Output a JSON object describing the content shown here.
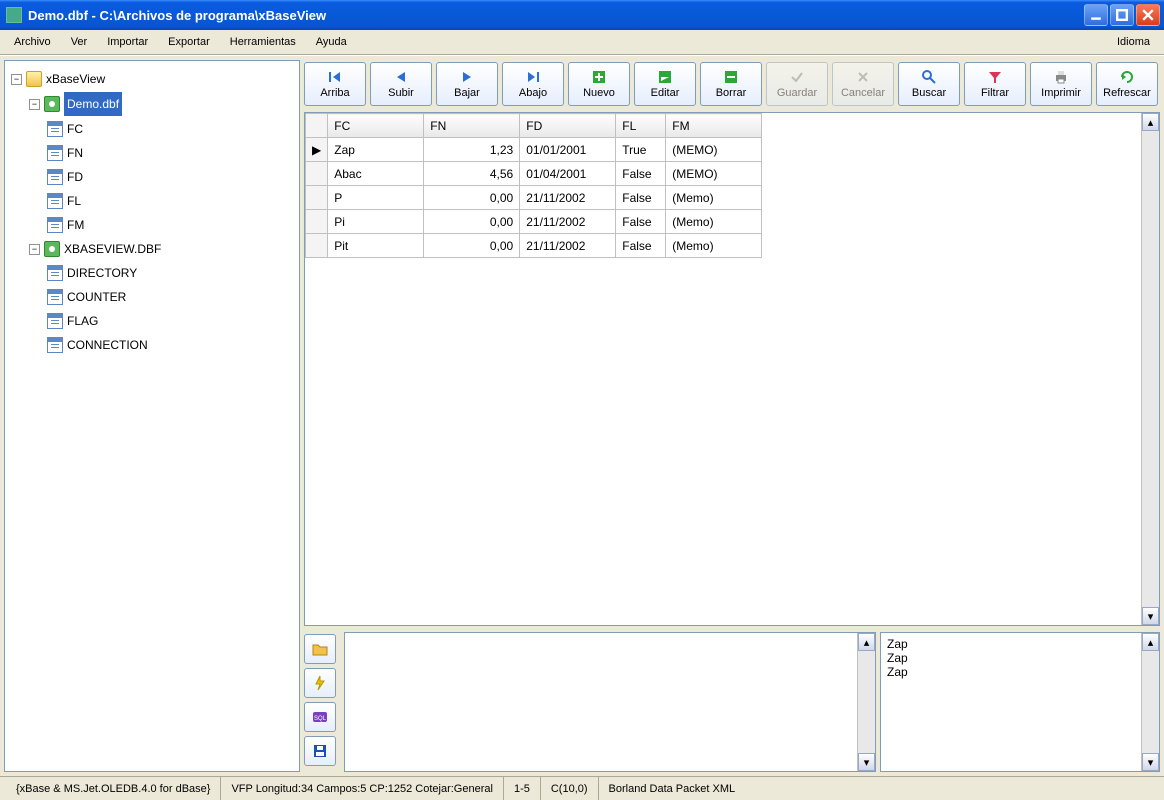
{
  "titlebar": {
    "title": "Demo.dbf - C:\\Archivos de programa\\xBaseView"
  },
  "menu": {
    "archivo": "Archivo",
    "ver": "Ver",
    "importar": "Importar",
    "exportar": "Exportar",
    "herramientas": "Herramientas",
    "ayuda": "Ayuda",
    "idioma": "Idioma"
  },
  "tree": {
    "root": "xBaseView",
    "demo": "Demo.dbf",
    "demo_fields": [
      "FC",
      "FN",
      "FD",
      "FL",
      "FM"
    ],
    "xbv": "XBASEVIEW.DBF",
    "xbv_fields": [
      "DIRECTORY",
      "COUNTER",
      "FLAG",
      "CONNECTION"
    ]
  },
  "toolbar": {
    "arriba": "Arriba",
    "subir": "Subir",
    "bajar": "Bajar",
    "abajo": "Abajo",
    "nuevo": "Nuevo",
    "editar": "Editar",
    "borrar": "Borrar",
    "guardar": "Guardar",
    "cancelar": "Cancelar",
    "buscar": "Buscar",
    "filtrar": "Filtrar",
    "imprimir": "Imprimir",
    "refrescar": "Refrescar"
  },
  "grid": {
    "headers": [
      "FC",
      "FN",
      "FD",
      "FL",
      "FM"
    ],
    "rows": [
      {
        "marker": "▶",
        "FC": "Zap",
        "FN": "1,23",
        "FD": "01/01/2001",
        "FL": "True",
        "FM": "(MEMO)"
      },
      {
        "marker": "",
        "FC": "Abac",
        "FN": "4,56",
        "FD": "01/04/2001",
        "FL": "False",
        "FM": "(MEMO)"
      },
      {
        "marker": "",
        "FC": "P",
        "FN": "0,00",
        "FD": "21/11/2002",
        "FL": "False",
        "FM": "(Memo)"
      },
      {
        "marker": "",
        "FC": "Pi",
        "FN": "0,00",
        "FD": "21/11/2002",
        "FL": "False",
        "FM": "(Memo)"
      },
      {
        "marker": "",
        "FC": "Pit",
        "FN": "0,00",
        "FD": "21/11/2002",
        "FL": "False",
        "FM": "(Memo)"
      }
    ]
  },
  "memo_left": "",
  "memo_right": "Zap\nZap\nZap",
  "status": {
    "engine": "{xBase & MS.Jet.OLEDB.4.0 for dBase}",
    "info": "VFP  Longitud:34  Campos:5  CP:1252  Cotejar:General",
    "range": "1-5",
    "coltype": "C(10,0)",
    "packet": "Borland Data Packet XML"
  }
}
